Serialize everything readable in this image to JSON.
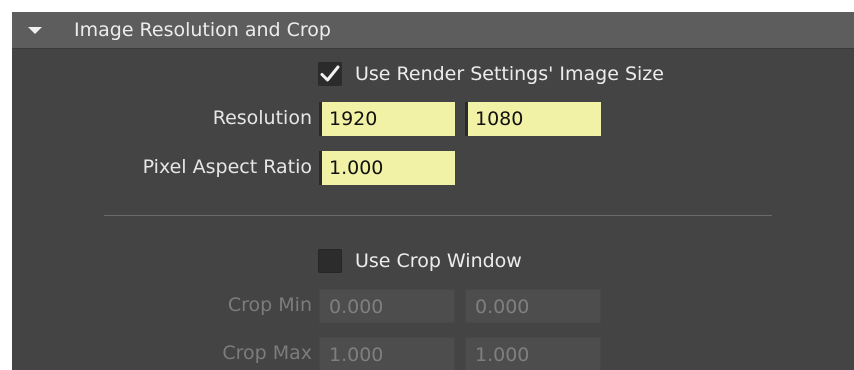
{
  "section": {
    "title": "Image Resolution and Crop"
  },
  "use_render_settings": {
    "label": "Use Render Settings' Image Size",
    "checked": true
  },
  "resolution": {
    "label": "Resolution",
    "width": "1920",
    "height": "1080"
  },
  "pixel_aspect_ratio": {
    "label": "Pixel Aspect Ratio",
    "value": "1.000"
  },
  "use_crop_window": {
    "label": "Use Crop Window",
    "checked": false
  },
  "crop_min": {
    "label": "Crop Min",
    "x": "0.000",
    "y": "0.000"
  },
  "crop_max": {
    "label": "Crop Max",
    "x": "1.000",
    "y": "1.000"
  },
  "colors": {
    "panel_bg": "#444444",
    "header_bg": "#5d5d5d",
    "field_active": "#f2f2a6",
    "field_inactive": "#4d4d4d"
  }
}
